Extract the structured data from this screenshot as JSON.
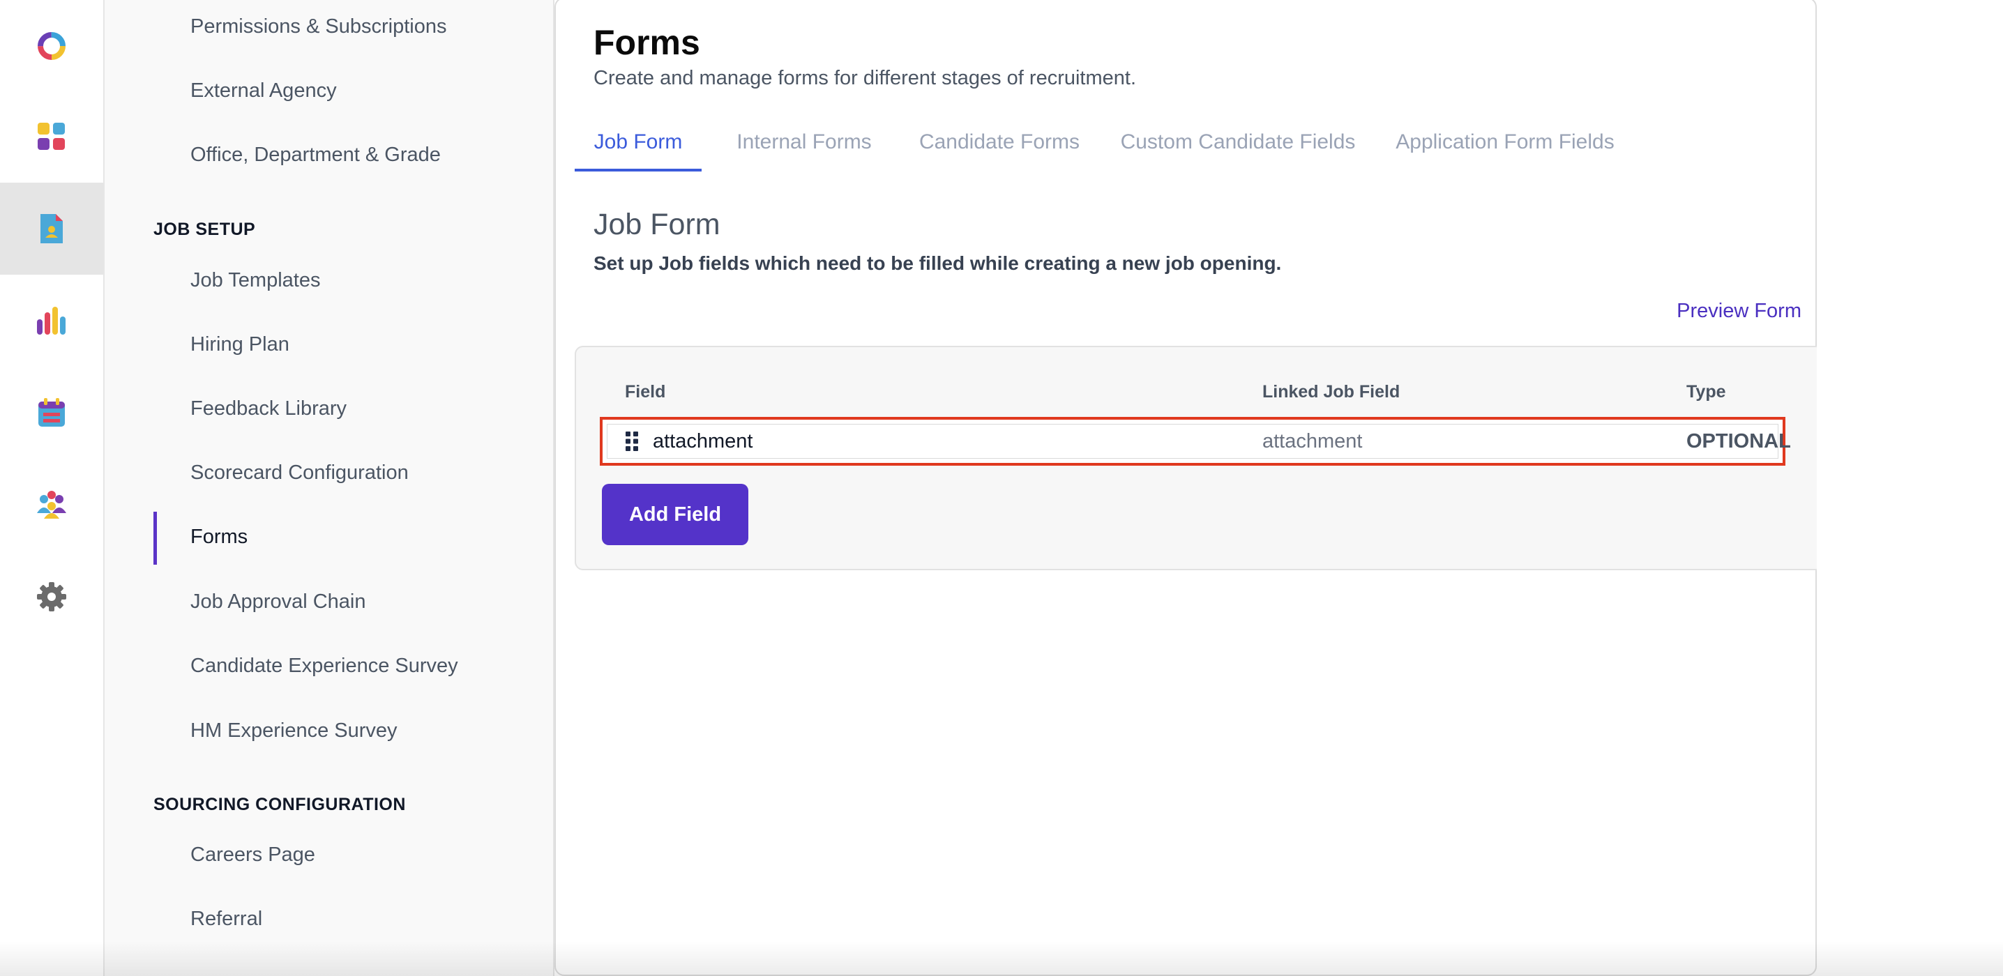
{
  "rail": {
    "items": [
      {
        "name": "logo-icon"
      },
      {
        "name": "dashboard-icon"
      },
      {
        "name": "jobs-icon"
      },
      {
        "name": "reports-icon"
      },
      {
        "name": "calendar-icon"
      },
      {
        "name": "people-icon"
      },
      {
        "name": "settings-icon"
      }
    ],
    "active": "jobs-icon"
  },
  "sidebar": {
    "top_links": [
      "Permissions & Subscriptions",
      "External Agency",
      "Office, Department & Grade"
    ],
    "job_setup_heading": "JOB SETUP",
    "job_setup_links": [
      "Job Templates",
      "Hiring Plan",
      "Feedback Library",
      "Scorecard Configuration",
      "Forms",
      "Job Approval Chain",
      "Candidate Experience Survey",
      "HM Experience Survey"
    ],
    "active_link": "Forms",
    "sourcing_heading": "SOURCING CONFIGURATION",
    "sourcing_links": [
      "Careers Page",
      "Referral"
    ]
  },
  "main": {
    "title": "Forms",
    "subtitle": "Create and manage forms for different stages of recruitment.",
    "tabs": [
      "Job Form",
      "Internal Forms",
      "Candidate Forms",
      "Custom Candidate Fields",
      "Application Form Fields"
    ],
    "active_tab": "Job Form",
    "section_title": "Job Form",
    "section_subtitle": "Set up Job fields which need to be filled while creating a new job opening.",
    "preview_label": "Preview Form",
    "table": {
      "headers": {
        "field": "Field",
        "linked": "Linked Job Field",
        "type": "Type"
      },
      "rows": [
        {
          "field": "attachment",
          "linked": "attachment",
          "type": "OPTIONAL"
        }
      ]
    },
    "add_field_label": "Add Field"
  },
  "colors": {
    "accent": "#5433c9",
    "tab_active": "#3b5bdb",
    "highlight": "#e0391f"
  }
}
